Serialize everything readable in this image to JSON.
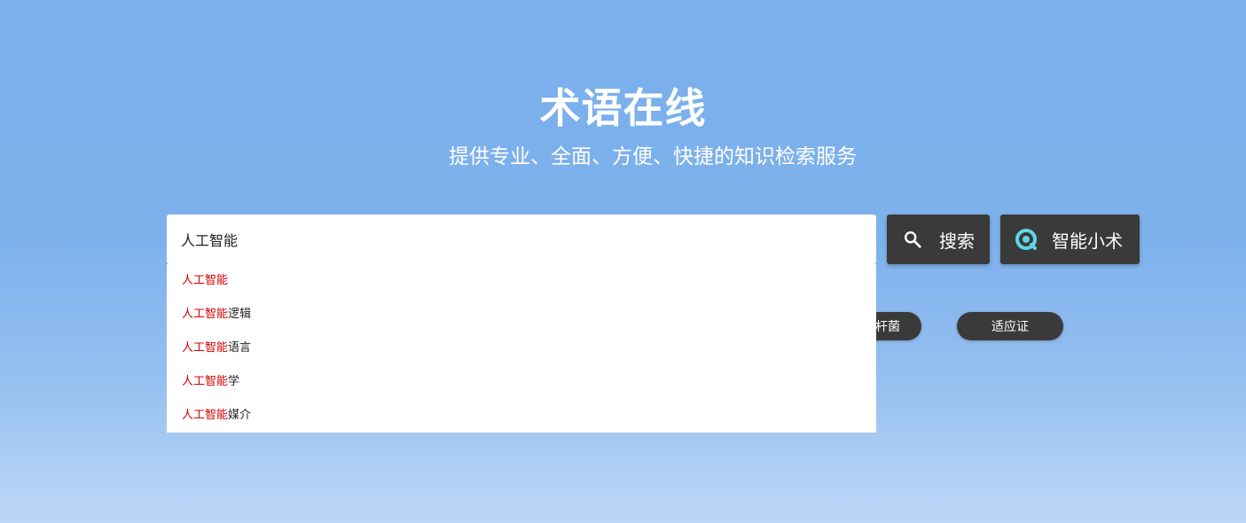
{
  "header": {
    "title": "术语在线",
    "subtitle": "提供专业、全面、方便、快捷的知识检索服务"
  },
  "search": {
    "value": "人工智能",
    "search_button_label": "搜索",
    "ai_button_label": "智能小术"
  },
  "suggestions": [
    {
      "match": "人工智能",
      "rest": ""
    },
    {
      "match": "人工智能",
      "rest": "逻辑"
    },
    {
      "match": "人工智能",
      "rest": "语言"
    },
    {
      "match": "人工智能",
      "rest": "学"
    },
    {
      "match": "人工智能",
      "rest": "媒介"
    }
  ],
  "tags": [
    {
      "label": "杆菌"
    },
    {
      "label": "适应证"
    }
  ],
  "colors": {
    "background": "#7db1ec",
    "button": "#3a3a3a",
    "highlight": "#d40000",
    "ai_icon": "#5fd6e6"
  },
  "icons": {
    "search_button": "search-icon",
    "ai_button": "ai-assistant-icon"
  }
}
